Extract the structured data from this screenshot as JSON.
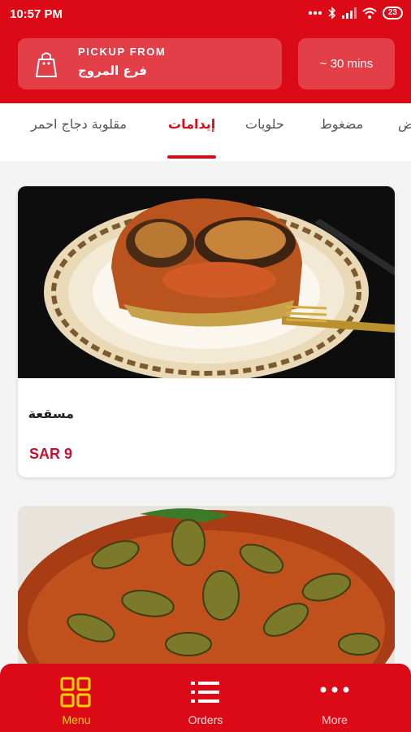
{
  "status_bar": {
    "time": "10:57 PM",
    "battery": "23"
  },
  "header": {
    "pickup_label": "PICKUP FROM",
    "branch_name": "فرع المروج",
    "eta": "~ 30 mins"
  },
  "tabs": [
    {
      "label": "مقلوبة دجاج احمر",
      "active": false
    },
    {
      "label": "إيدامات",
      "active": true
    },
    {
      "label": "حلويات",
      "active": false
    },
    {
      "label": "مضغوط",
      "active": false
    },
    {
      "label": "ض",
      "active": false
    }
  ],
  "products": [
    {
      "name": "مسقعة",
      "price": "SAR 9",
      "image": "moussaka-plate"
    },
    {
      "name": "",
      "price": "",
      "image": "okra-stew-bowl"
    }
  ],
  "bottom_nav": [
    {
      "label": "Menu",
      "icon": "grid-icon",
      "active": true
    },
    {
      "label": "Orders",
      "icon": "list-icon",
      "active": false
    },
    {
      "label": "More",
      "icon": "dots-icon",
      "active": false
    }
  ],
  "colors": {
    "brand": "#dc0a16",
    "active_nav": "#ffd400",
    "price": "#c8102e"
  }
}
